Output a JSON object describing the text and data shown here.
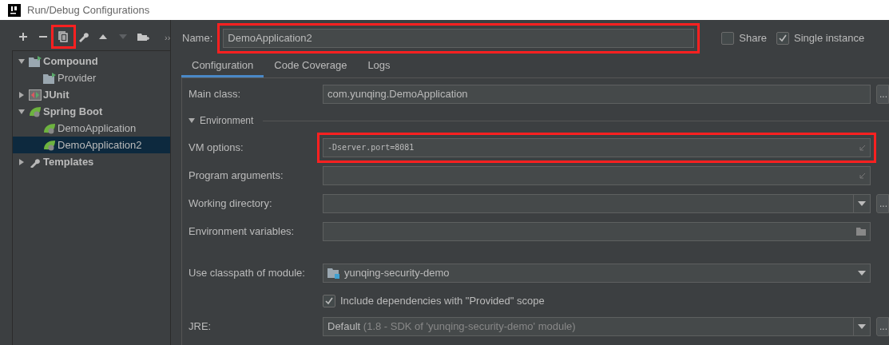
{
  "window": {
    "title": "Run/Debug Configurations"
  },
  "toolbar": [
    {
      "kind": "add",
      "disabled": false
    },
    {
      "kind": "remove",
      "disabled": false
    },
    {
      "kind": "copy",
      "highlighted": true,
      "disabled": false
    },
    {
      "kind": "edit",
      "disabled": false
    },
    {
      "kind": "up",
      "disabled": false
    },
    {
      "kind": "down",
      "disabled": true
    },
    {
      "kind": "folder",
      "disabled": false
    }
  ],
  "expand_toggle": "››",
  "tree": [
    {
      "label": "Compound",
      "kind": "compound",
      "expanded": true,
      "selected": false,
      "children": [
        {
          "label": "Provider",
          "kind": "compound",
          "selected": false
        }
      ]
    },
    {
      "label": "JUnit",
      "kind": "junit",
      "expanded": false,
      "selected": false
    },
    {
      "label": "Spring Boot",
      "kind": "spring",
      "expanded": true,
      "selected": false,
      "children": [
        {
          "label": "DemoApplication",
          "kind": "spring",
          "selected": false
        },
        {
          "label": "DemoApplication2",
          "kind": "spring",
          "selected": true
        }
      ]
    },
    {
      "label": "Templates",
      "kind": "wrench",
      "expanded": false,
      "selected": false
    }
  ],
  "name_field": {
    "label": "Name:",
    "value": "DemoApplication2",
    "highlighted": true
  },
  "options": [
    {
      "label": "Share",
      "checked": false
    },
    {
      "label": "Single instance",
      "checked": true
    }
  ],
  "tabs": [
    {
      "label": "Configuration",
      "selected": true
    },
    {
      "label": "Code Coverage",
      "selected": false
    },
    {
      "label": "Logs",
      "selected": false
    }
  ],
  "form": [
    {
      "kind": "text",
      "label": "Main class:",
      "value": "com.yunqing.DemoApplication",
      "browse": "..."
    },
    {
      "kind": "section",
      "label": "Environment",
      "expanded": true
    },
    {
      "kind": "expandable",
      "label": "VM options:",
      "value": "-Dserver.port=8081",
      "highlighted": true
    },
    {
      "kind": "expandable",
      "label": "Program arguments:"
    },
    {
      "kind": "combo",
      "label": "Working directory:",
      "browse": "..."
    },
    {
      "kind": "folder",
      "label": "Environment variables:"
    },
    {
      "kind": "module",
      "label": "Use classpath of module:",
      "value": "yunqing-security-demo"
    },
    {
      "kind": "checkbox",
      "label": "Include dependencies with \"Provided\" scope",
      "checked": true
    },
    {
      "kind": "combo",
      "label": "JRE:",
      "value": "Default",
      "hint": "(1.8 - SDK of 'yunqing-security-demo' module)",
      "browse": "..."
    }
  ]
}
